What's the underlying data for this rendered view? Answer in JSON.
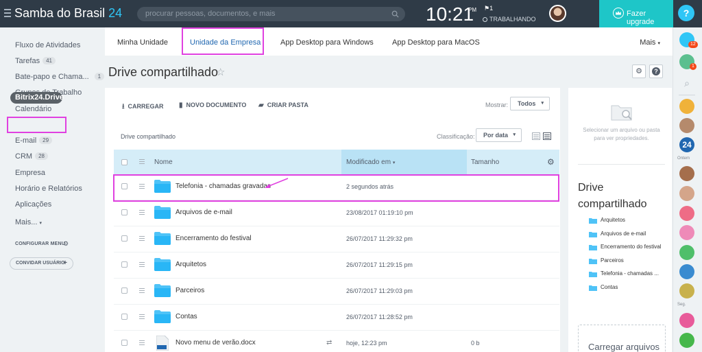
{
  "topbar": {
    "brand": "Samba do Brasil",
    "brand_num": "24",
    "search_placeholder": "procurar pessoas, documentos, e mais",
    "time": "10:21",
    "ampm": "PM",
    "flag_count": "1",
    "status": "TRABALHANDO",
    "upgrade_label": "Fazer upgrade",
    "help_label": "?"
  },
  "sidebar": {
    "items": [
      {
        "label": "Fluxo de Atividades"
      },
      {
        "label": "Tarefas",
        "badge": "41"
      },
      {
        "label": "Bate-papo e Chama...",
        "badge": "1"
      },
      {
        "label": "Grupos de Trabalho"
      },
      {
        "label": "Calendário"
      },
      {
        "label": "Bitrix24.Drive"
      },
      {
        "label": "E-mail",
        "badge": "29"
      },
      {
        "label": "CRM",
        "badge": "28"
      },
      {
        "label": "Empresa"
      },
      {
        "label": "Horário e Relatórios"
      },
      {
        "label": "Aplicações"
      },
      {
        "label": "Mais..."
      }
    ],
    "configure_menu": "CONFIGURAR MENU",
    "invite_users": "CONVIDAR USUÁRIO"
  },
  "tabs": {
    "items": [
      "Minha Unidade",
      "Unidade da Empresa",
      "App Desktop para Windows",
      "App Desktop para MacOS"
    ],
    "more": "Mais"
  },
  "page": {
    "title": "Drive compartilhado"
  },
  "toolbar": {
    "upload": "CARREGAR",
    "new_doc": "NOVO DOCUMENTO",
    "new_folder": "CRIAR PASTA",
    "show_label": "Mostrar:",
    "show_value": "Todos",
    "breadcrumb": "Drive compartilhado",
    "sort_label": "Classificação:",
    "sort_value": "Por data"
  },
  "table": {
    "columns": {
      "name": "Nome",
      "modified": "Modificado em",
      "size": "Tamanho"
    },
    "rows": [
      {
        "name": "Telefonia - chamadas gravadas",
        "modified": "2 segundos atrás",
        "size": "",
        "type": "folder"
      },
      {
        "name": "Arquivos de e-mail",
        "modified": "23/08/2017 01:19:10 pm",
        "size": "",
        "type": "folder"
      },
      {
        "name": "Encerramento do festival",
        "modified": "26/07/2017 11:29:32 pm",
        "size": "",
        "type": "folder"
      },
      {
        "name": "Arquitetos",
        "modified": "26/07/2017 11:29:15 pm",
        "size": "",
        "type": "folder"
      },
      {
        "name": "Parceiros",
        "modified": "26/07/2017 11:29:03 pm",
        "size": "",
        "type": "folder"
      },
      {
        "name": "Contas",
        "modified": "26/07/2017 11:28:52 pm",
        "size": "",
        "type": "folder"
      },
      {
        "name": "Novo menu de verão.docx",
        "modified": "hoje, 12:23 pm",
        "size": "0 b",
        "type": "doc"
      }
    ]
  },
  "props": {
    "hint": "Selecionar um arquivo ou pasta para ver propriedades.",
    "title": "Drive compartilhado",
    "items": [
      "Arquitetos",
      "Arquivos de e-mail",
      "Encerramento do festival",
      "Parceiros",
      "Telefonia - chamadas ...",
      "Contas"
    ],
    "upload": "Carregar arquivos"
  },
  "rail": {
    "badge_1": "12",
    "badge_2": "1",
    "label_today": "Ontem",
    "label_seg": "Seg."
  },
  "colors": {
    "highlight": "#e040e0",
    "accent": "#2fc6f6",
    "folder": "#4fc3f7",
    "upgrade": "#1ec6c8"
  }
}
